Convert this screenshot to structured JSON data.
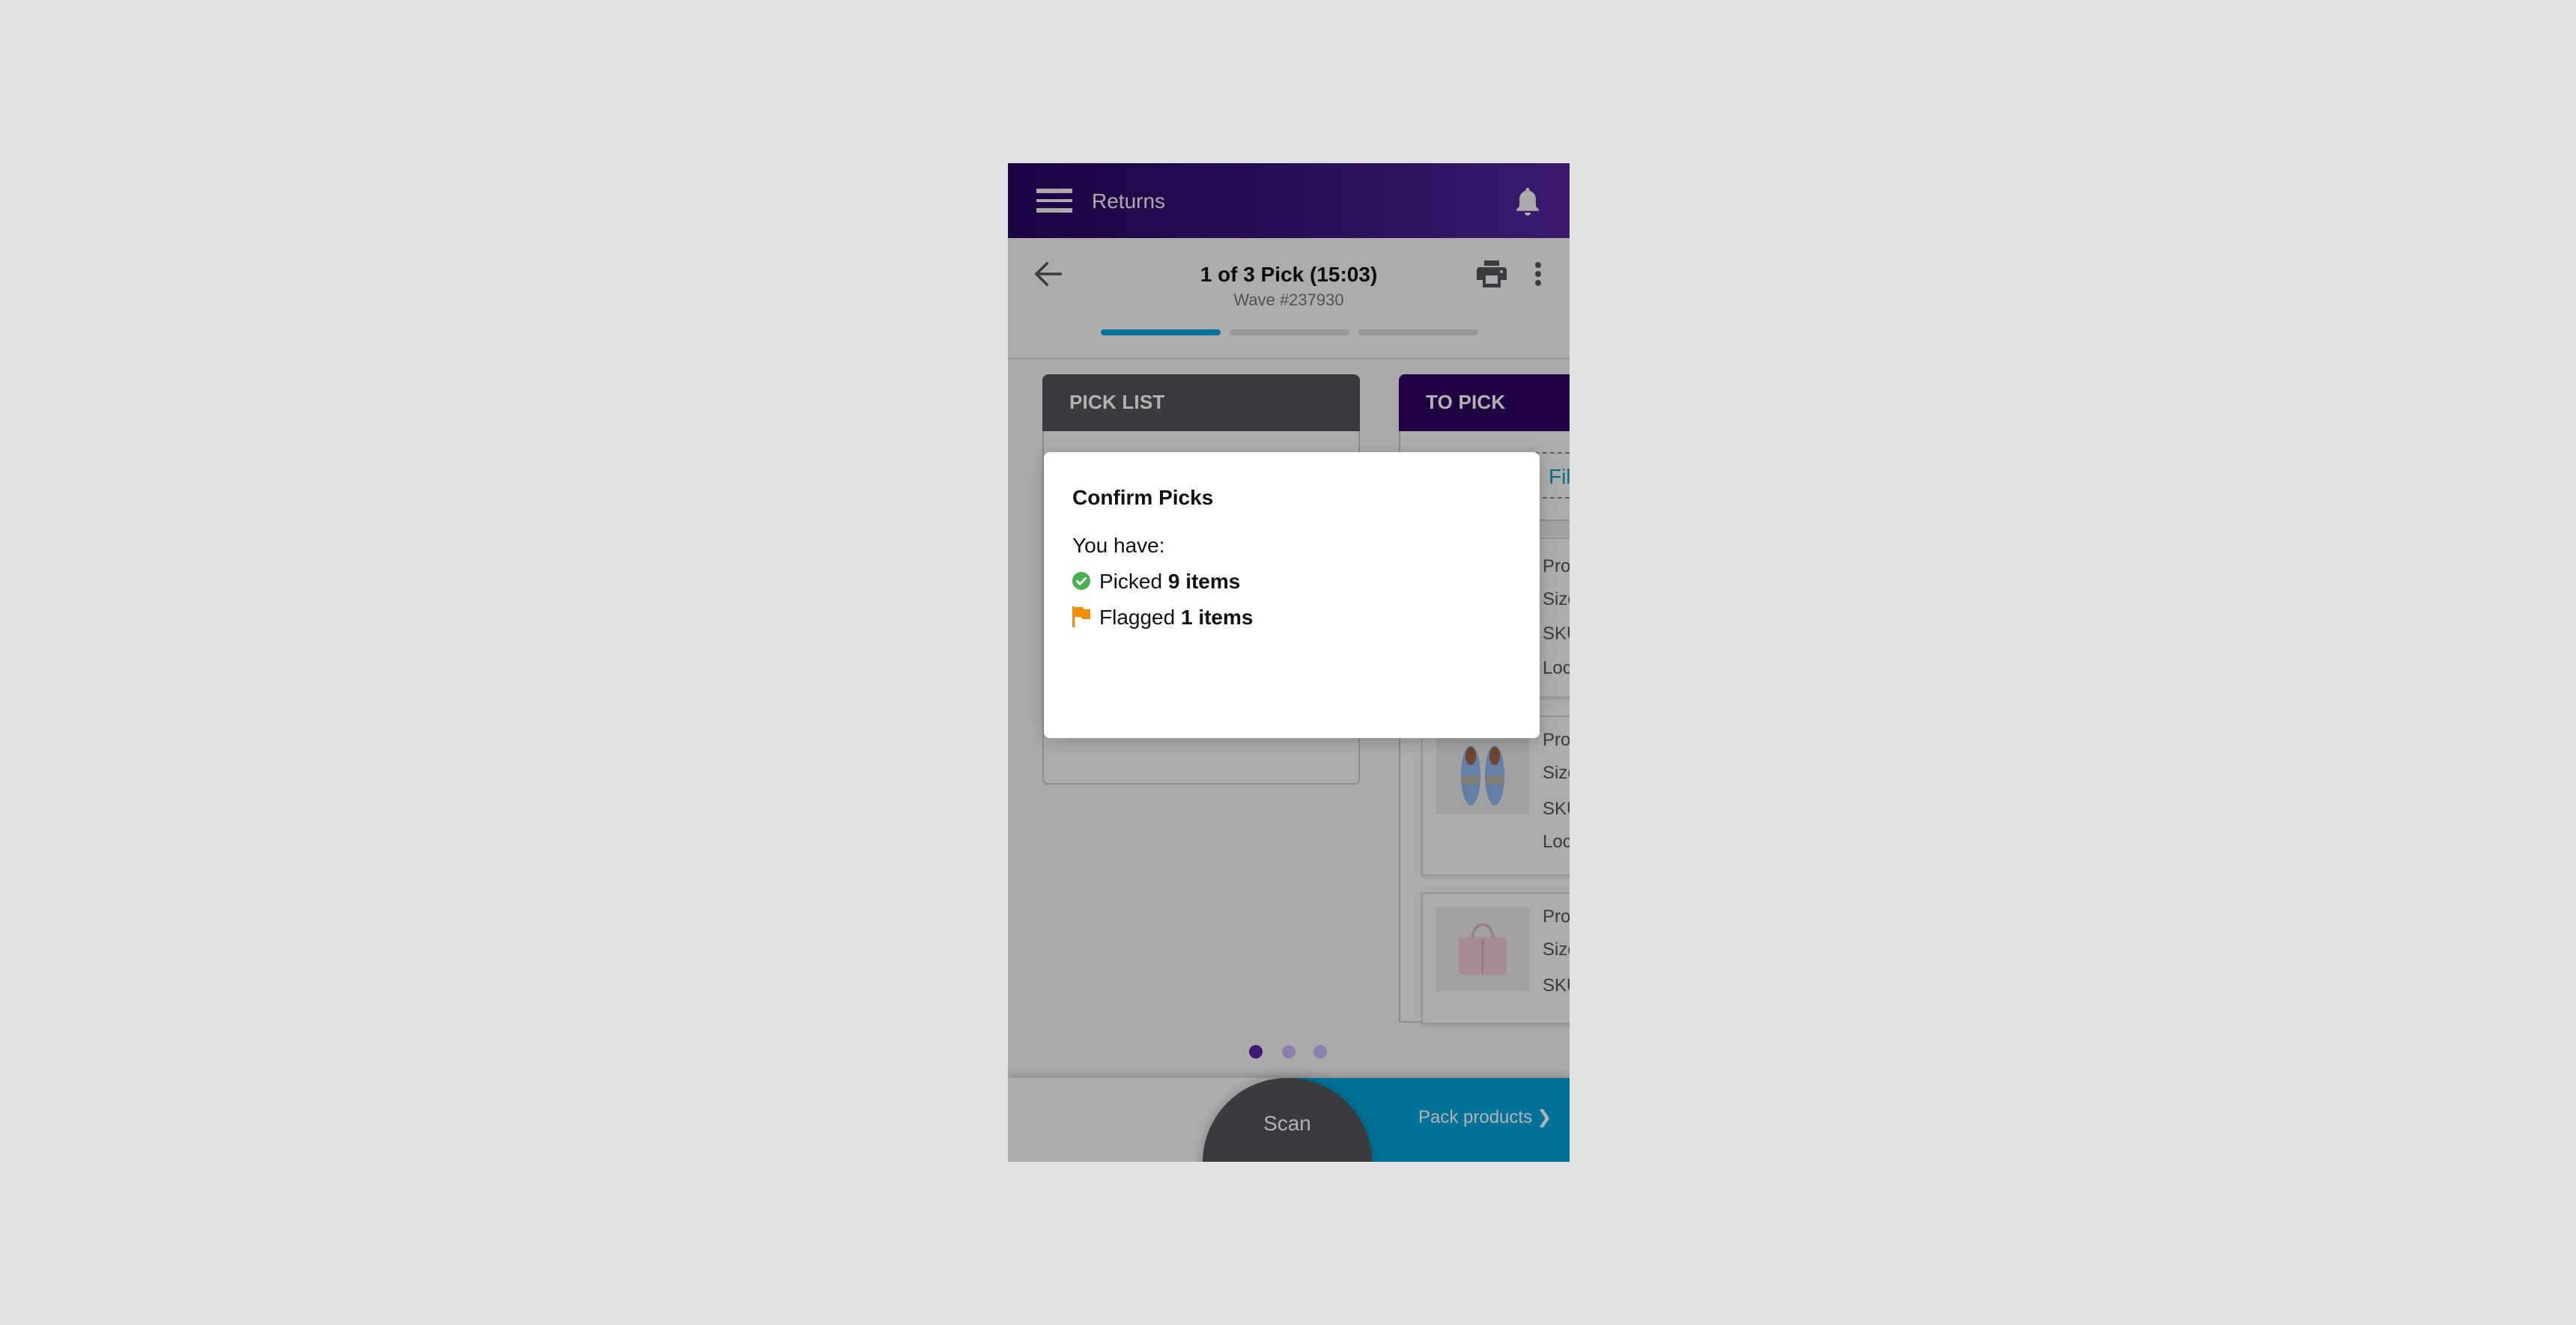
{
  "app_header": {
    "title": "Returns",
    "menu_icon": "hamburger-menu-icon",
    "notification_icon": "bell-icon"
  },
  "sub_header": {
    "title": "1 of 3 Pick (15:03)",
    "subtitle": "Wave #237930",
    "back_icon": "arrow-left-icon",
    "print_icon": "printer-icon",
    "more_icon": "kebab-menu-icon",
    "progress": {
      "current_step": 1,
      "total_steps": 3
    }
  },
  "columns": {
    "pick_list": {
      "title": "PICK LIST"
    },
    "to_pick": {
      "title": "TO PICK",
      "filter_label": "Filter",
      "cards": [
        {
          "thumb": "hidden-product",
          "fields": [
            "Prod",
            "Size",
            "SKU",
            "Loca"
          ]
        },
        {
          "thumb": "blue-shoes",
          "fields": [
            "Prod",
            "Size",
            "SKU",
            "Loca"
          ]
        },
        {
          "thumb": "pink-handbag",
          "fields": [
            "Prod",
            "Size",
            "SKU"
          ]
        }
      ]
    }
  },
  "pager": {
    "pages": 3,
    "active_index": 0
  },
  "bottom_bar": {
    "scan_label": "Scan",
    "pack_label": "Pack products",
    "pack_chevron": "❯"
  },
  "modal": {
    "title": "Confirm Picks",
    "intro": "You have:",
    "lines": [
      {
        "icon": "check-circle-icon",
        "prefix": "Picked",
        "value": "9 items",
        "color": "#4caf50"
      },
      {
        "icon": "flag-icon",
        "prefix": "Flagged",
        "value": "1 items",
        "color": "#f08c00"
      }
    ]
  },
  "colors": {
    "brand_purple": "#2b005f",
    "accent_blue": "#00a4da",
    "success_green": "#4caf50",
    "warning_orange": "#f08c00"
  }
}
